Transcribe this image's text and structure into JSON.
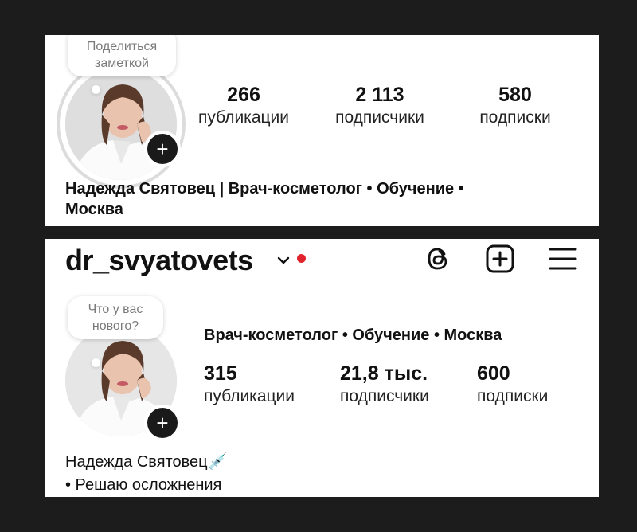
{
  "profile_old": {
    "note": {
      "line1": "Поделиться",
      "line2": "заметкой"
    },
    "stats": [
      {
        "num": "266",
        "label": "публикации"
      },
      {
        "num": "2 113",
        "label": "подписчики"
      },
      {
        "num": "580",
        "label": "подписки"
      }
    ],
    "bio_line1": "Надежда Святовец | Врач-косметолог • Обучение •",
    "bio_line2": "Москва"
  },
  "profile_new": {
    "username": "dr_svyatovets",
    "note": {
      "line1": "Что у вас",
      "line2": "нового?"
    },
    "category": "Врач-косметолог • Обучение • Москва",
    "stats": [
      {
        "num": "315",
        "label": "публикации"
      },
      {
        "num": "21,8 тыс.",
        "label": "подписчики"
      },
      {
        "num": "600",
        "label": "подписки"
      }
    ],
    "bio_name": "Надежда Святовец💉",
    "bio_line2": "• Решаю осложнения"
  },
  "icons": [
    "threads-icon",
    "add-post-icon",
    "menu-icon",
    "plus-icon",
    "chevron-down-icon"
  ],
  "colors": {
    "notification_dot": "#e0242e",
    "background": "#1c1c1c"
  }
}
